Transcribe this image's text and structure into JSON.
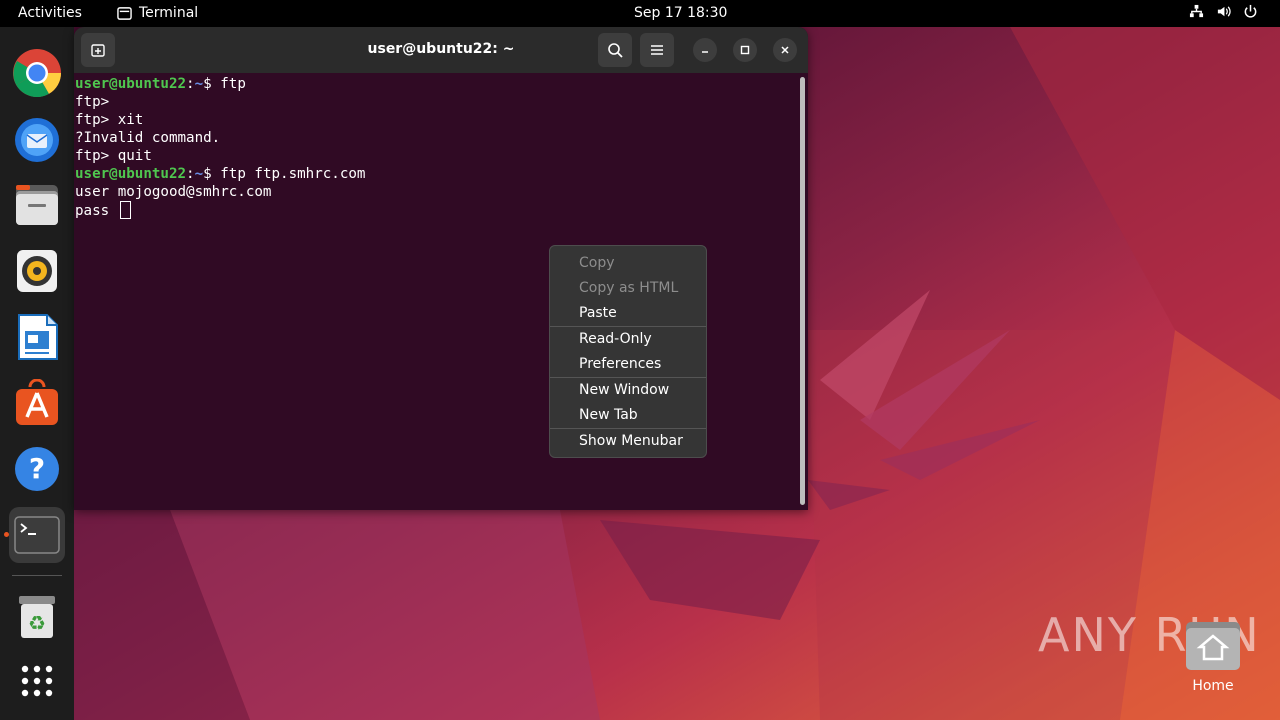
{
  "topbar": {
    "activities": "Activities",
    "app_name": "Terminal",
    "clock": "Sep 17  18:30"
  },
  "dock": {
    "items": [
      "chrome-icon",
      "thunderbird-icon",
      "files-icon",
      "rhythmbox-icon",
      "writer-icon",
      "app-center-icon",
      "help-icon",
      "terminal-icon",
      "trash-icon",
      "show-apps-icon"
    ]
  },
  "terminal": {
    "title": "user@ubuntu22: ~",
    "lines": [
      {
        "user": "user@ubuntu22",
        "path": "~",
        "cmd": "ftp"
      },
      {
        "text": "ftp>"
      },
      {
        "text": "ftp> xit"
      },
      {
        "text": "?Invalid command."
      },
      {
        "text": "ftp> quit"
      },
      {
        "user": "user@ubuntu22",
        "path": "~",
        "cmd": "ftp ftp.smhrc.com"
      },
      {
        "text": "user mojogood@smhrc.com"
      },
      {
        "text": "pass "
      }
    ]
  },
  "context_menu": {
    "groups": [
      [
        {
          "label": "Copy",
          "disabled": true
        },
        {
          "label": "Copy as HTML",
          "disabled": true
        },
        {
          "label": "Paste",
          "disabled": false
        }
      ],
      [
        {
          "label": "Read-Only",
          "disabled": false
        },
        {
          "label": "Preferences",
          "disabled": false
        }
      ],
      [
        {
          "label": "New Window",
          "disabled": false
        },
        {
          "label": "New Tab",
          "disabled": false
        }
      ],
      [
        {
          "label": "Show Menubar",
          "disabled": false
        }
      ]
    ]
  },
  "desktop": {
    "home_label": "Home",
    "watermark": "ANY RUN"
  },
  "colors": {
    "terminal_bg": "#300a24",
    "prompt_user": "#4fc64f",
    "prompt_path": "#6a8de6",
    "accent": "#e95420"
  }
}
